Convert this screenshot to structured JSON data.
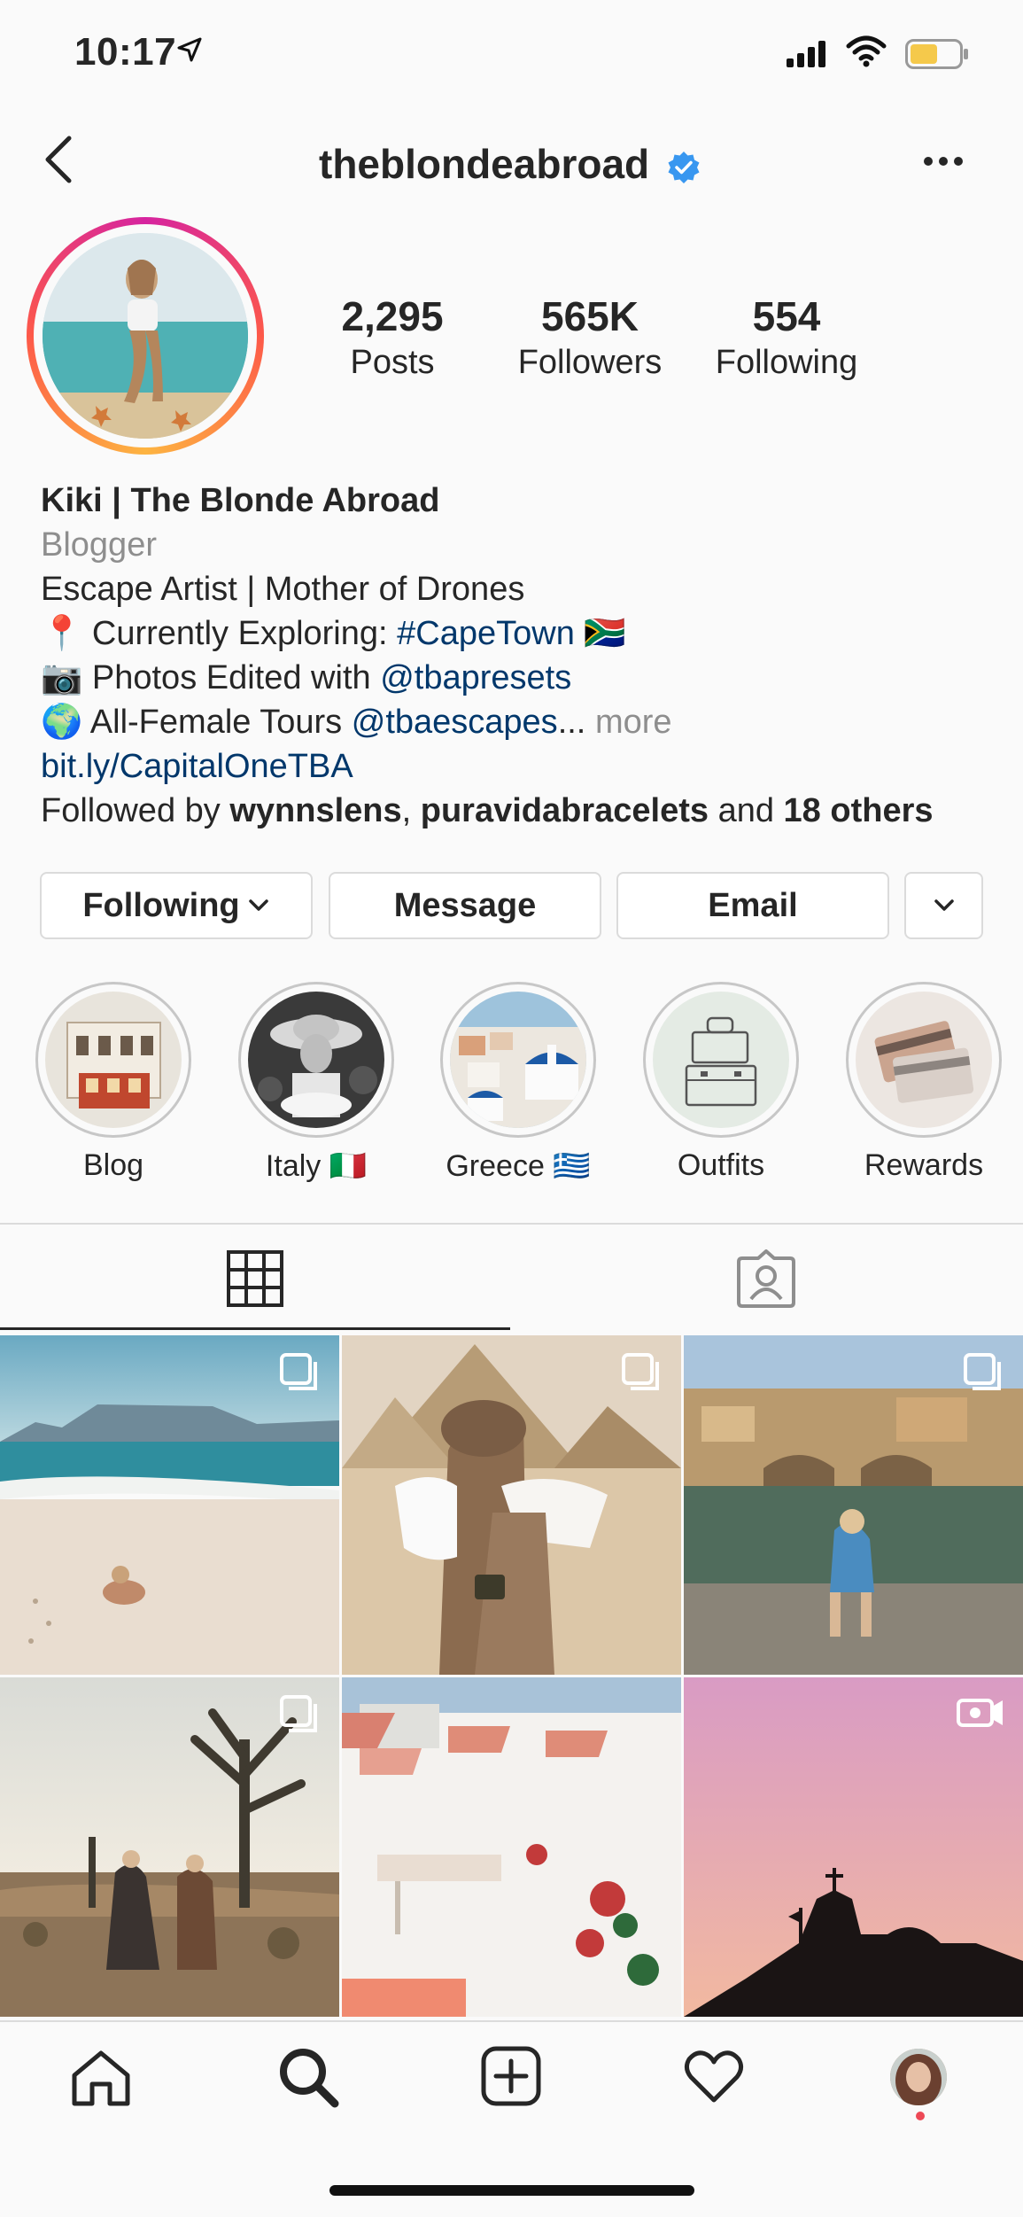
{
  "status_bar": {
    "time": "10:17"
  },
  "header": {
    "username": "theblondeabroad"
  },
  "stats": [
    {
      "value": "2,295",
      "label": "Posts"
    },
    {
      "value": "565K",
      "label": "Followers"
    },
    {
      "value": "554",
      "label": "Following"
    }
  ],
  "bio": {
    "name": "Kiki | The Blonde Abroad",
    "category": "Blogger",
    "line1": "Escape Artist | Mother of Drones",
    "line2_emoji": "📍",
    "line2_text": "Currently Exploring:",
    "line2_tag": "#CapeTown",
    "line2_flag": "🇿🇦",
    "line3_emoji": "📷",
    "line3_text": "Photos Edited with",
    "line3_mention": "@tbapresets",
    "line4_emoji": "🌍",
    "line4_text": "All-Female Tours",
    "line4_mention": "@tbaescapes",
    "line4_ellipsis": "...",
    "line4_more": "more",
    "website": "bit.ly/CapitalOneTBA",
    "followed_by_prefix": "Followed by",
    "followed_by_1": "wynnslens",
    "followed_by_sep": ",",
    "followed_by_2": "puravidabracelets",
    "followed_by_and": "and",
    "followed_by_others": "18 others"
  },
  "buttons": {
    "following": "Following",
    "message": "Message",
    "email": "Email"
  },
  "highlights": [
    {
      "label": "Blog"
    },
    {
      "label": "Italy 🇮🇹"
    },
    {
      "label": "Greece 🇬🇷"
    },
    {
      "label": "Outfits"
    },
    {
      "label": "Rewards"
    }
  ],
  "colors": {
    "text": "#262626",
    "muted": "#8e8e8e",
    "link": "#00376b",
    "verified": "#3897f0",
    "notification_dot": "#ed4956",
    "battery": "#f5c94b"
  },
  "icons": {
    "back": "chevron-left-icon",
    "verified": "verified-badge-icon",
    "more": "more-horizontal-icon",
    "grid_tab": "grid-icon",
    "tagged_tab": "tagged-user-icon",
    "nav": [
      "home-icon",
      "search-icon",
      "new-post-icon",
      "activity-heart-icon",
      "profile-avatar-icon"
    ],
    "multi_post": "carousel-icon",
    "video_post": "video-icon"
  }
}
